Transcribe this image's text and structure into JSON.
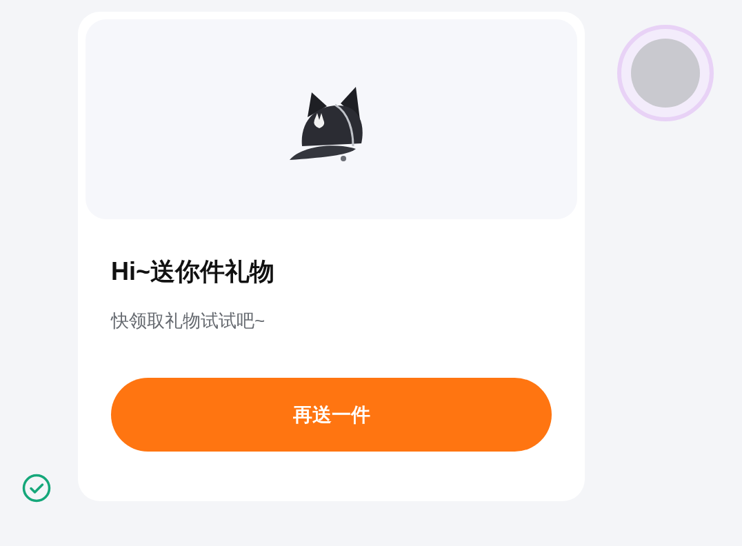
{
  "gift_card": {
    "title": "Hi~送你件礼物",
    "subtitle": "快领取礼物试试吧~",
    "button": "再送一件"
  },
  "message_status": {
    "delivered": true
  }
}
